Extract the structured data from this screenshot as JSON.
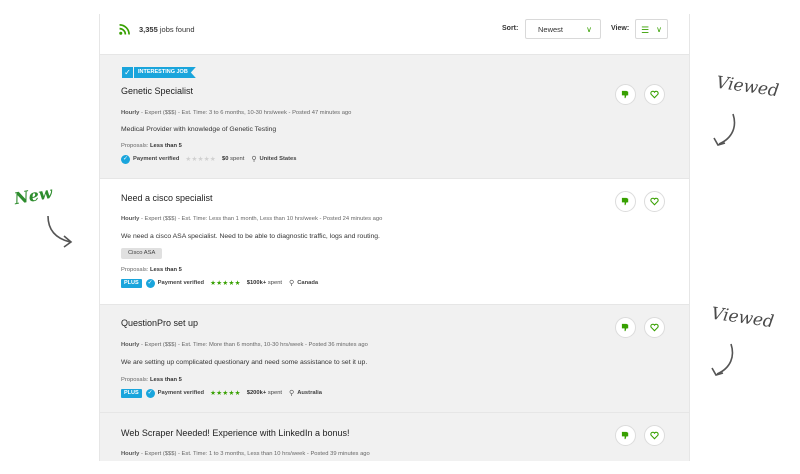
{
  "toolbar": {
    "jobs_count": "3,355",
    "jobs_found_label": "jobs found",
    "sort_label": "Sort:",
    "sort_value": "Newest",
    "view_label": "View:"
  },
  "jobs": [
    {
      "badge": "INTERESTING JOB",
      "title": "Genetic Specialist",
      "meta_type": "Hourly",
      "meta_rest": " - Expert ($$$) - Est. Time: 3 to 6 months, 10-30 hrs/week - Posted 47 minutes ago",
      "description": "Medical Provider with knowledge of Genetic Testing",
      "proposals_label": "Proposals:",
      "proposals_value": "Less than 5",
      "verified": "Payment verified",
      "stars": "★★★★★",
      "spent_amount": "$0",
      "spent_label": "spent",
      "location": "United States"
    },
    {
      "title": "Need a cisco specialist",
      "meta_type": "Hourly",
      "meta_rest": " - Expert ($$$) - Est. Time: Less than 1 month, Less than 10 hrs/week - Posted 24 minutes ago",
      "description": "We need a cisco ASA specialist. Need to be able to diagnostic traffic, logs and routing.",
      "skill_tag": "Cisco ASA",
      "proposals_label": "Proposals:",
      "proposals_value": "Less than 5",
      "plus": "PLUS",
      "verified": "Payment verified",
      "stars": "★★★★★",
      "spent_amount": "$100k+",
      "spent_label": "spent",
      "location": "Canada"
    },
    {
      "title": "QuestionPro set up",
      "meta_type": "Hourly",
      "meta_rest": " - Expert ($$$) - Est. Time: More than 6 months, 10-30 hrs/week - Posted 36 minutes ago",
      "description": "We are setting up complicated questionary and need some assistance to set it up.",
      "proposals_label": "Proposals:",
      "proposals_value": "Less than 5",
      "plus": "PLUS",
      "verified": "Payment verified",
      "stars": "★★★★★",
      "spent_amount": "$200k+",
      "spent_label": "spent",
      "location": "Australia"
    },
    {
      "title": "Web Scraper Needed! Experience with LinkedIn a bonus!",
      "meta_type": "Hourly",
      "meta_rest": " - Expert ($$$) - Est. Time: 1 to 3 months, Less than 10 hrs/week - Posted 39 minutes ago"
    }
  ],
  "annotations": {
    "viewed_1": "Viewed",
    "viewed_2": "Viewed",
    "new": "New"
  },
  "colors": {
    "accent_green": "#37a000",
    "badge_blue": "#1aa5dc",
    "viewed_bg": "#f1f1f1"
  },
  "icons": {
    "feed": "rss-icon",
    "dislike": "thumbs-down-icon",
    "save": "heart-icon"
  }
}
